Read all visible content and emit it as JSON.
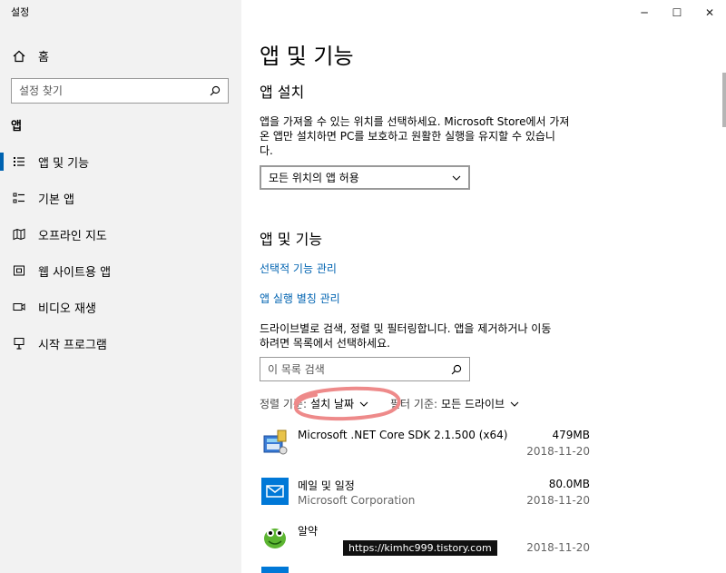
{
  "window": {
    "title": "설정",
    "controls": {
      "minimize": "─",
      "maximize": "☐",
      "close": "✕"
    }
  },
  "sidebar": {
    "home_label": "홈",
    "search_placeholder": "설정 찾기",
    "section_label": "앱",
    "items": [
      {
        "label": "앱 및 기능",
        "icon": "list-icon",
        "active": true
      },
      {
        "label": "기본 앱",
        "icon": "default-apps-icon",
        "active": false
      },
      {
        "label": "오프라인 지도",
        "icon": "map-icon",
        "active": false
      },
      {
        "label": "웹 사이트용 앱",
        "icon": "web-icon",
        "active": false
      },
      {
        "label": "비디오 재생",
        "icon": "video-icon",
        "active": false
      },
      {
        "label": "시작 프로그램",
        "icon": "startup-icon",
        "active": false
      }
    ]
  },
  "main": {
    "page_title": "앱 및 기능",
    "install": {
      "heading": "앱 설치",
      "description_line1": "앱을 가져올 수 있는 위치를 선택하세요. Microsoft Store에서 가져",
      "description_line2": "온 앱만 설치하면 PC를 보호하고 원활한 실행을 유지할 수 있습니",
      "description_line3": "다.",
      "dropdown_value": "모든 위치의 앱 허용"
    },
    "apps": {
      "heading": "앱 및 기능",
      "link_optional": "선택적 기능 관리",
      "link_alias": "앱 실행 별칭 관리",
      "description_line1": "드라이브별로 검색, 정렬 및 필터링합니다. 앱을 제거하거나 이동",
      "description_line2": "하려면 목록에서 선택하세요.",
      "search_placeholder": "이 목록 검색",
      "sort_label": "정렬 기준:",
      "sort_value": "설치 날짜",
      "filter_label": "필터 기준:",
      "filter_value": "모든 드라이브",
      "list": [
        {
          "name": "Microsoft .NET Core SDK 2.1.500 (x64)",
          "publisher": "",
          "size": "479MB",
          "date": "2018-11-20"
        },
        {
          "name": "메일 및 일정",
          "publisher": "Microsoft Corporation",
          "size": "80.0MB",
          "date": "2018-11-20"
        },
        {
          "name": "알약",
          "publisher": "",
          "size": "",
          "date": "2018-11-20"
        }
      ]
    }
  },
  "watermark": "https://kimhc999.tistory.com",
  "colors": {
    "accent": "#0063b1",
    "sidebar_bg": "#f2f2f2",
    "annotation": "#ee8a8a"
  }
}
